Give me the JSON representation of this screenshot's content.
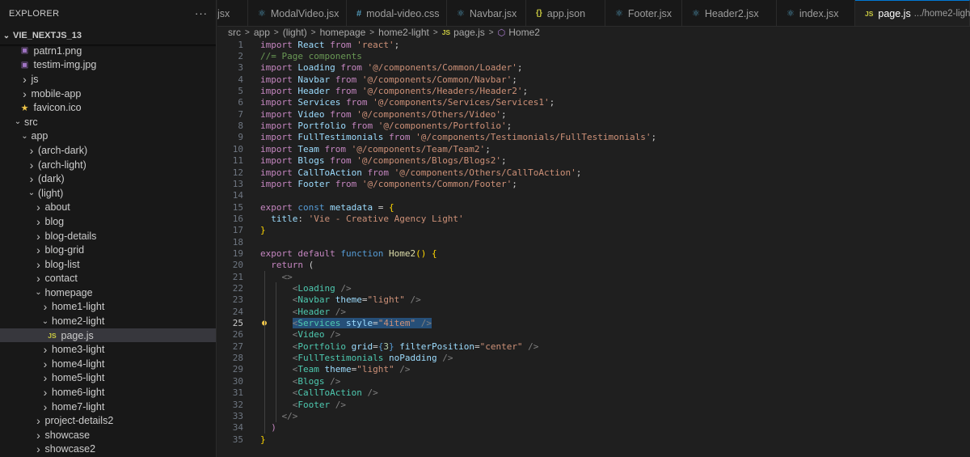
{
  "explorer": {
    "title": "EXPLORER",
    "more": "···",
    "project": "VIE_NEXTJS_13",
    "items": [
      {
        "label": "patrn1.png",
        "depth": 1,
        "kind": "img"
      },
      {
        "label": "testim-img.jpg",
        "depth": 1,
        "kind": "img"
      },
      {
        "label": "js",
        "depth": 1,
        "kind": "folder",
        "open": false
      },
      {
        "label": "mobile-app",
        "depth": 1,
        "kind": "folder",
        "open": false
      },
      {
        "label": "favicon.ico",
        "depth": 1,
        "kind": "star"
      },
      {
        "label": "src",
        "depth": 0,
        "kind": "folder",
        "open": true
      },
      {
        "label": "app",
        "depth": 1,
        "kind": "folder",
        "open": true
      },
      {
        "label": "(arch-dark)",
        "depth": 2,
        "kind": "folder",
        "open": false
      },
      {
        "label": "(arch-light)",
        "depth": 2,
        "kind": "folder",
        "open": false
      },
      {
        "label": "(dark)",
        "depth": 2,
        "kind": "folder",
        "open": false
      },
      {
        "label": "(light)",
        "depth": 2,
        "kind": "folder",
        "open": true
      },
      {
        "label": "about",
        "depth": 3,
        "kind": "folder",
        "open": false
      },
      {
        "label": "blog",
        "depth": 3,
        "kind": "folder",
        "open": false
      },
      {
        "label": "blog-details",
        "depth": 3,
        "kind": "folder",
        "open": false
      },
      {
        "label": "blog-grid",
        "depth": 3,
        "kind": "folder",
        "open": false
      },
      {
        "label": "blog-list",
        "depth": 3,
        "kind": "folder",
        "open": false
      },
      {
        "label": "contact",
        "depth": 3,
        "kind": "folder",
        "open": false
      },
      {
        "label": "homepage",
        "depth": 3,
        "kind": "folder",
        "open": true
      },
      {
        "label": "home1-light",
        "depth": 4,
        "kind": "folder",
        "open": false
      },
      {
        "label": "home2-light",
        "depth": 4,
        "kind": "folder",
        "open": true
      },
      {
        "label": "page.js",
        "depth": 5,
        "kind": "js",
        "active": true
      },
      {
        "label": "home3-light",
        "depth": 4,
        "kind": "folder",
        "open": false
      },
      {
        "label": "home4-light",
        "depth": 4,
        "kind": "folder",
        "open": false
      },
      {
        "label": "home5-light",
        "depth": 4,
        "kind": "folder",
        "open": false
      },
      {
        "label": "home6-light",
        "depth": 4,
        "kind": "folder",
        "open": false
      },
      {
        "label": "home7-light",
        "depth": 4,
        "kind": "folder",
        "open": false
      },
      {
        "label": "project-details2",
        "depth": 3,
        "kind": "folder",
        "open": false
      },
      {
        "label": "showcase",
        "depth": 3,
        "kind": "folder",
        "open": false
      },
      {
        "label": "showcase2",
        "depth": 3,
        "kind": "folder",
        "open": false
      }
    ]
  },
  "tabs": [
    {
      "label": "jsx",
      "icon": "none"
    },
    {
      "label": "ModalVideo.jsx",
      "icon": "react"
    },
    {
      "label": "modal-video.css",
      "icon": "css"
    },
    {
      "label": "Navbar.jsx",
      "icon": "react"
    },
    {
      "label": "app.json",
      "icon": "json"
    },
    {
      "label": "Footer.jsx",
      "icon": "react"
    },
    {
      "label": "Header2.jsx",
      "icon": "react"
    },
    {
      "label": "index.jsx",
      "icon": "react"
    },
    {
      "label": "page.js",
      "icon": "js",
      "active": true,
      "desc": ".../home2-light"
    }
  ],
  "icons": {
    "react": "⚛",
    "css": "#",
    "json": "{}",
    "js": "JS",
    "close": "✕",
    "chevron_right": "›",
    "chevron_down": "⌄",
    "cube": "⬡",
    "bulb": "💡",
    "img": "▣",
    "star": "★"
  },
  "breadcrumb": [
    "src",
    "app",
    "(light)",
    "homepage",
    "home2-light",
    "page.js",
    "Home2"
  ],
  "editor": {
    "current_line": 25,
    "lines": [
      [
        [
          "kw",
          "import "
        ],
        [
          "var",
          "React "
        ],
        [
          "kw",
          "from "
        ],
        [
          "str",
          "'react'"
        ],
        [
          "plain",
          ";"
        ]
      ],
      [
        [
          "cmt",
          "//= Page components"
        ]
      ],
      [
        [
          "kw",
          "import "
        ],
        [
          "var",
          "Loading "
        ],
        [
          "kw",
          "from "
        ],
        [
          "str",
          "'@/components/Common/Loader'"
        ],
        [
          "plain",
          ";"
        ]
      ],
      [
        [
          "kw",
          "import "
        ],
        [
          "var",
          "Navbar "
        ],
        [
          "kw",
          "from "
        ],
        [
          "str",
          "'@/components/Common/Navbar'"
        ],
        [
          "plain",
          ";"
        ]
      ],
      [
        [
          "kw",
          "import "
        ],
        [
          "var",
          "Header "
        ],
        [
          "kw",
          "from "
        ],
        [
          "str",
          "'@/components/Headers/Header2'"
        ],
        [
          "plain",
          ";"
        ]
      ],
      [
        [
          "kw",
          "import "
        ],
        [
          "var",
          "Services "
        ],
        [
          "kw",
          "from "
        ],
        [
          "str",
          "'@/components/Services/Services1'"
        ],
        [
          "plain",
          ";"
        ]
      ],
      [
        [
          "kw",
          "import "
        ],
        [
          "var",
          "Video "
        ],
        [
          "kw",
          "from "
        ],
        [
          "str",
          "'@/components/Others/Video'"
        ],
        [
          "plain",
          ";"
        ]
      ],
      [
        [
          "kw",
          "import "
        ],
        [
          "var",
          "Portfolio "
        ],
        [
          "kw",
          "from "
        ],
        [
          "str",
          "'@/components/Portfolio'"
        ],
        [
          "plain",
          ";"
        ]
      ],
      [
        [
          "kw",
          "import "
        ],
        [
          "var",
          "FullTestimonials "
        ],
        [
          "kw",
          "from "
        ],
        [
          "str",
          "'@/components/Testimonials/FullTestimonials'"
        ],
        [
          "plain",
          ";"
        ]
      ],
      [
        [
          "kw",
          "import "
        ],
        [
          "var",
          "Team "
        ],
        [
          "kw",
          "from "
        ],
        [
          "str",
          "'@/components/Team/Team2'"
        ],
        [
          "plain",
          ";"
        ]
      ],
      [
        [
          "kw",
          "import "
        ],
        [
          "var",
          "Blogs "
        ],
        [
          "kw",
          "from "
        ],
        [
          "str",
          "'@/components/Blogs/Blogs2'"
        ],
        [
          "plain",
          ";"
        ]
      ],
      [
        [
          "kw",
          "import "
        ],
        [
          "var",
          "CallToAction "
        ],
        [
          "kw",
          "from "
        ],
        [
          "str",
          "'@/components/Others/CallToAction'"
        ],
        [
          "plain",
          ";"
        ]
      ],
      [
        [
          "kw",
          "import "
        ],
        [
          "var",
          "Footer "
        ],
        [
          "kw",
          "from "
        ],
        [
          "str",
          "'@/components/Common/Footer'"
        ],
        [
          "plain",
          ";"
        ]
      ],
      [],
      [
        [
          "kw",
          "export "
        ],
        [
          "kw2",
          "const "
        ],
        [
          "var",
          "metadata "
        ],
        [
          "plain",
          "= "
        ],
        [
          "yel",
          "{"
        ]
      ],
      [
        [
          "plain",
          "  "
        ],
        [
          "var",
          "title"
        ],
        [
          "plain",
          ": "
        ],
        [
          "str",
          "'Vie - Creative Agency Light'"
        ]
      ],
      [
        [
          "yel",
          "}"
        ]
      ],
      [],
      [
        [
          "kw",
          "export "
        ],
        [
          "kw",
          "default "
        ],
        [
          "kw2",
          "function "
        ],
        [
          "fn",
          "Home2"
        ],
        [
          "yel",
          "() {"
        ]
      ],
      [
        [
          "plain",
          "  "
        ],
        [
          "kw",
          "return "
        ],
        [
          "plain",
          "("
        ]
      ],
      [
        [
          "plain",
          "    "
        ],
        [
          "punc",
          "<>"
        ]
      ],
      [
        [
          "plain",
          "      "
        ],
        [
          "punc",
          "<"
        ],
        [
          "tag",
          "Loading"
        ],
        [
          "punc",
          " />"
        ]
      ],
      [
        [
          "plain",
          "      "
        ],
        [
          "punc",
          "<"
        ],
        [
          "tag",
          "Navbar"
        ],
        [
          "plain",
          " "
        ],
        [
          "var",
          "theme"
        ],
        [
          "plain",
          "="
        ],
        [
          "str",
          "\"light\""
        ],
        [
          "punc",
          " />"
        ]
      ],
      [
        [
          "plain",
          "      "
        ],
        [
          "punc",
          "<"
        ],
        [
          "tag",
          "Header"
        ],
        [
          "punc",
          " />"
        ]
      ],
      [
        [
          "plain",
          "      "
        ],
        [
          "sel:punc",
          "<"
        ],
        [
          "sel:tag",
          "Services"
        ],
        [
          "sel:plain",
          " "
        ],
        [
          "sel:var",
          "style"
        ],
        [
          "sel:plain",
          "="
        ],
        [
          "sel:str",
          "\"4item\""
        ],
        [
          "sel:punc",
          " />"
        ]
      ],
      [
        [
          "plain",
          "      "
        ],
        [
          "punc",
          "<"
        ],
        [
          "tag",
          "Video"
        ],
        [
          "punc",
          " />"
        ]
      ],
      [
        [
          "plain",
          "      "
        ],
        [
          "punc",
          "<"
        ],
        [
          "tag",
          "Portfolio"
        ],
        [
          "plain",
          " "
        ],
        [
          "var",
          "grid"
        ],
        [
          "plain",
          "="
        ],
        [
          "kw2",
          "{"
        ],
        [
          "num",
          "3"
        ],
        [
          "kw2",
          "}"
        ],
        [
          "plain",
          " "
        ],
        [
          "var",
          "filterPosition"
        ],
        [
          "plain",
          "="
        ],
        [
          "str",
          "\"center\""
        ],
        [
          "punc",
          " />"
        ]
      ],
      [
        [
          "plain",
          "      "
        ],
        [
          "punc",
          "<"
        ],
        [
          "tag",
          "FullTestimonials"
        ],
        [
          "plain",
          " "
        ],
        [
          "var",
          "noPadding"
        ],
        [
          "punc",
          " />"
        ]
      ],
      [
        [
          "plain",
          "      "
        ],
        [
          "punc",
          "<"
        ],
        [
          "tag",
          "Team"
        ],
        [
          "plain",
          " "
        ],
        [
          "var",
          "theme"
        ],
        [
          "plain",
          "="
        ],
        [
          "str",
          "\"light\""
        ],
        [
          "punc",
          " />"
        ]
      ],
      [
        [
          "plain",
          "      "
        ],
        [
          "punc",
          "<"
        ],
        [
          "tag",
          "Blogs"
        ],
        [
          "punc",
          " />"
        ]
      ],
      [
        [
          "plain",
          "      "
        ],
        [
          "punc",
          "<"
        ],
        [
          "tag",
          "CallToAction"
        ],
        [
          "punc",
          " />"
        ]
      ],
      [
        [
          "plain",
          "      "
        ],
        [
          "punc",
          "<"
        ],
        [
          "tag",
          "Footer"
        ],
        [
          "punc",
          " />"
        ]
      ],
      [
        [
          "plain",
          "    "
        ],
        [
          "punc",
          "</>"
        ]
      ],
      [
        [
          "plain",
          "  "
        ],
        [
          "kw",
          ")"
        ]
      ],
      [
        [
          "yel",
          "}"
        ]
      ]
    ]
  }
}
